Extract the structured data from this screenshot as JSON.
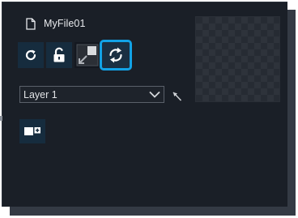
{
  "file": {
    "name": "MyFile01",
    "icon": "document-icon"
  },
  "toolbar": {
    "buttons": [
      {
        "icon": "refresh-icon"
      },
      {
        "icon": "unlock-icon"
      },
      {
        "icon": "image-resize-icon"
      },
      {
        "icon": "swap-arrows-icon",
        "selected": true
      }
    ]
  },
  "layer_select": {
    "value": "Layer 1",
    "icon": "chevron-down-icon"
  },
  "pointer": {
    "icon": "cursor-arrow-icon"
  },
  "add_layer": {
    "icon": "add-layer-icon"
  },
  "colors": {
    "panel_bg": "#1a1f27",
    "button_bg": "#162c3e",
    "accent": "#12a2e6",
    "frame": "#343a44"
  }
}
